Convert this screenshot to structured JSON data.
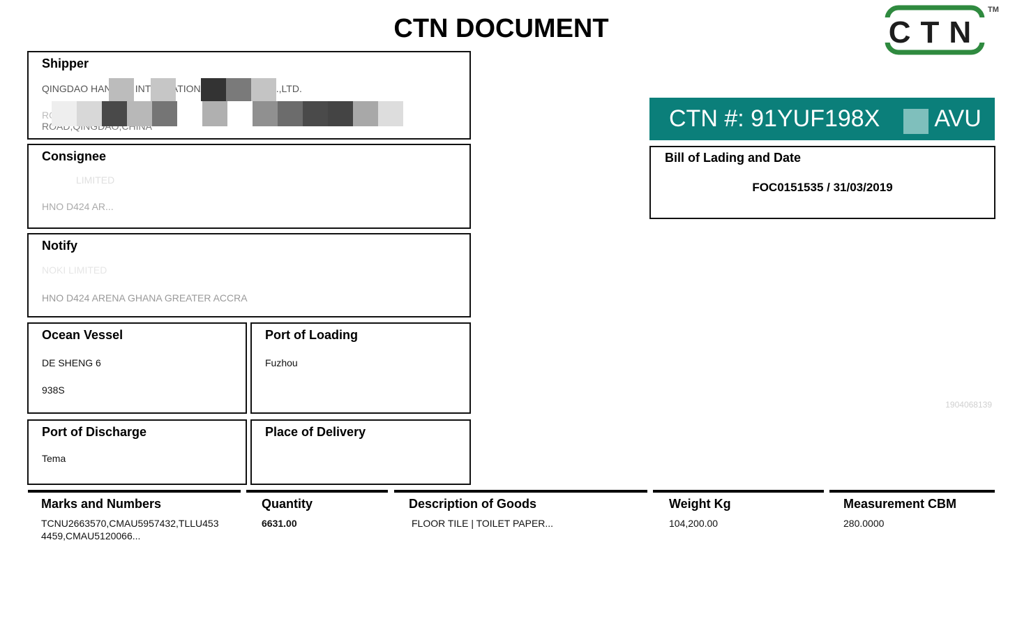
{
  "document": {
    "title": "CTN DOCUMENT",
    "logo_text": "CTN",
    "logo_tm": "TM",
    "brand_color": "#0b7f7a",
    "logo_green": "#2f8a3f"
  },
  "ctn": {
    "label": "CTN #:",
    "number_visible_start": "91YUF198X",
    "number_visible_end": "AVU"
  },
  "bill_of_lading": {
    "label": "Bill of Lading and Date",
    "value": "FOC0151535 / 31/03/2019"
  },
  "shipper": {
    "label": "Shipper",
    "lines": [
      "QINGDAO HANRUN INTERNATIONAL TRADING CO.,LTD.",
      "ROOM ... WORLD TRADE CENTER ... ZHONG ...NG",
      "ROAD,QINGDAO,CHINA"
    ]
  },
  "consignee": {
    "label": "Consignee",
    "lines": [
      "LIMITED",
      "HNO D424 AR..."
    ]
  },
  "notify": {
    "label": "Notify",
    "lines": [
      "NOKI LIMITED",
      "HNO D424 ARENA GHANA GREATER ACCRA"
    ]
  },
  "ocean_vessel": {
    "label": "Ocean Vessel",
    "lines": [
      "DE SHENG 6",
      "938S"
    ]
  },
  "port_of_loading": {
    "label": "Port of Loading",
    "value": "Fuzhou"
  },
  "port_of_discharge": {
    "label": "Port of Discharge",
    "value": "Tema"
  },
  "place_of_delivery": {
    "label": "Place of Delivery",
    "value": ""
  },
  "watermark_id": "1904068139",
  "goods_table": {
    "columns": [
      "Marks and Numbers",
      "Quantity",
      "Description of Goods",
      "Weight Kg",
      "Measurement CBM"
    ],
    "row": {
      "marks": "TCNU2663570,CMAU5957432,TLLU4534459,CMAU5120066...",
      "marks_line1": "TCNU2663570,CMAU5957432,TLLU453",
      "marks_line2": "4459,CMAU5120066...",
      "quantity": "6631.00",
      "description": "FLOOR TILE | TOILET PAPER...",
      "weight": "104,200.00",
      "measurement": "280.0000"
    }
  }
}
